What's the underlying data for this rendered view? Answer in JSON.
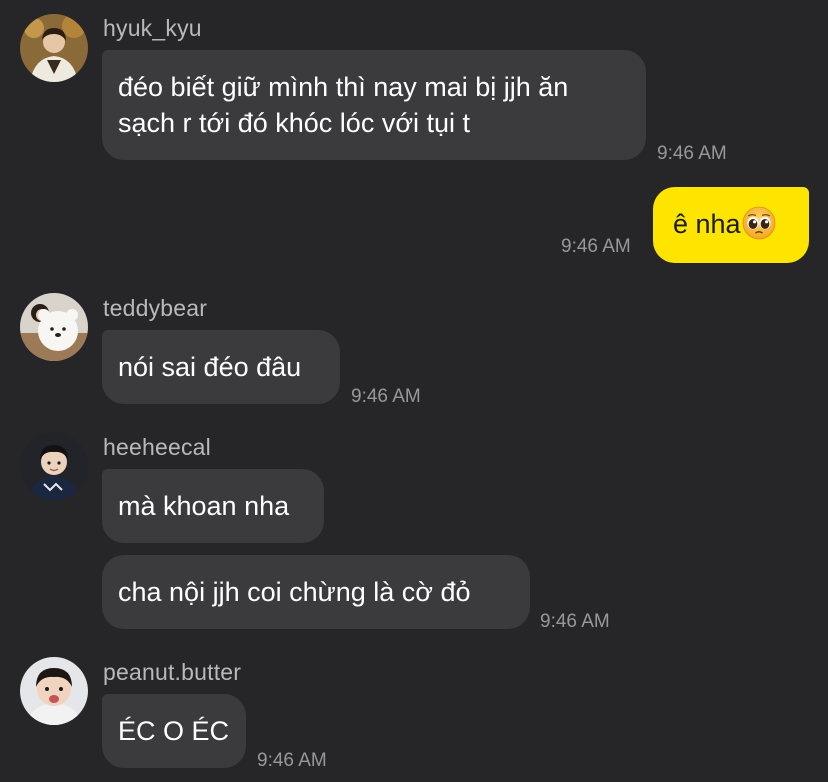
{
  "messages": [
    {
      "sender": "hyuk_kyu",
      "lines": [
        "đéo biết giữ mình thì nay mai bị jjh ăn",
        "sạch r tới đó khóc lóc với tụi t"
      ],
      "time": "9:46 AM"
    },
    {
      "sender": "me",
      "text": "ê nha",
      "emoji": "pleading-face-icon",
      "time": "9:46 AM"
    },
    {
      "sender": "teddybear",
      "text": "nói sai đéo đâu",
      "time": "9:46 AM"
    },
    {
      "sender": "heeheecal",
      "texts": [
        "mà khoan nha",
        "cha nội jjh coi chừng là cờ đỏ"
      ],
      "time": "9:46 AM"
    },
    {
      "sender": "peanut.butter",
      "text": "ÉC O ÉC",
      "time": "9:46 AM"
    }
  ],
  "colors": {
    "background": "#262628",
    "bubble_other": "#3b3b3e",
    "bubble_mine": "#fee500",
    "username": "#b9b9bc",
    "timestamp": "#98989c"
  }
}
